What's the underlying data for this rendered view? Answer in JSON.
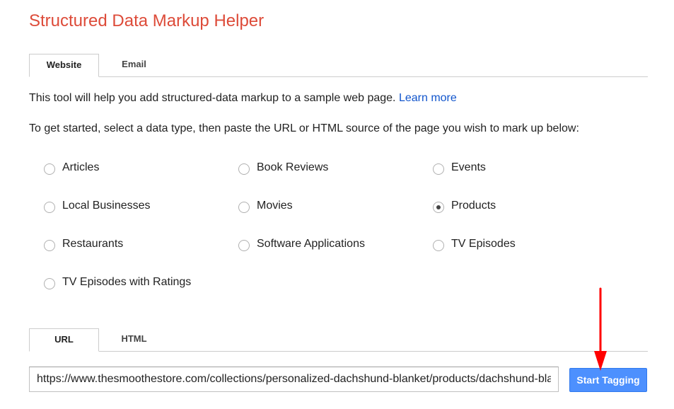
{
  "header": {
    "title": "Structured Data Markup Helper"
  },
  "source_tabs": [
    {
      "label": "Website",
      "active": true
    },
    {
      "label": "Email",
      "active": false
    }
  ],
  "intro": {
    "text": "This tool will help you add structured-data markup to a sample web page. ",
    "link_label": "Learn more"
  },
  "instructions": {
    "text": "To get started, select a data type, then paste the URL or HTML source of the page you wish to mark up below:"
  },
  "data_types": [
    {
      "label": "Articles",
      "selected": false
    },
    {
      "label": "Book Reviews",
      "selected": false
    },
    {
      "label": "Events",
      "selected": false
    },
    {
      "label": "Local Businesses",
      "selected": false
    },
    {
      "label": "Movies",
      "selected": false
    },
    {
      "label": "Products",
      "selected": true
    },
    {
      "label": "Restaurants",
      "selected": false
    },
    {
      "label": "Software Applications",
      "selected": false
    },
    {
      "label": "TV Episodes",
      "selected": false
    },
    {
      "label": "TV Episodes with Ratings",
      "selected": false
    }
  ],
  "input_tabs": [
    {
      "label": "URL",
      "active": true
    },
    {
      "label": "HTML",
      "active": false
    }
  ],
  "url_field": {
    "value": "https://www.thesmoothestore.com/collections/personalized-dachshund-blanket/products/dachshund-blanket"
  },
  "start_button": {
    "label": "Start Tagging"
  },
  "colors": {
    "title": "#dd4b39",
    "link": "#1155cc",
    "primary_button": "#4d90fe",
    "annotation_arrow": "#ff0000"
  }
}
